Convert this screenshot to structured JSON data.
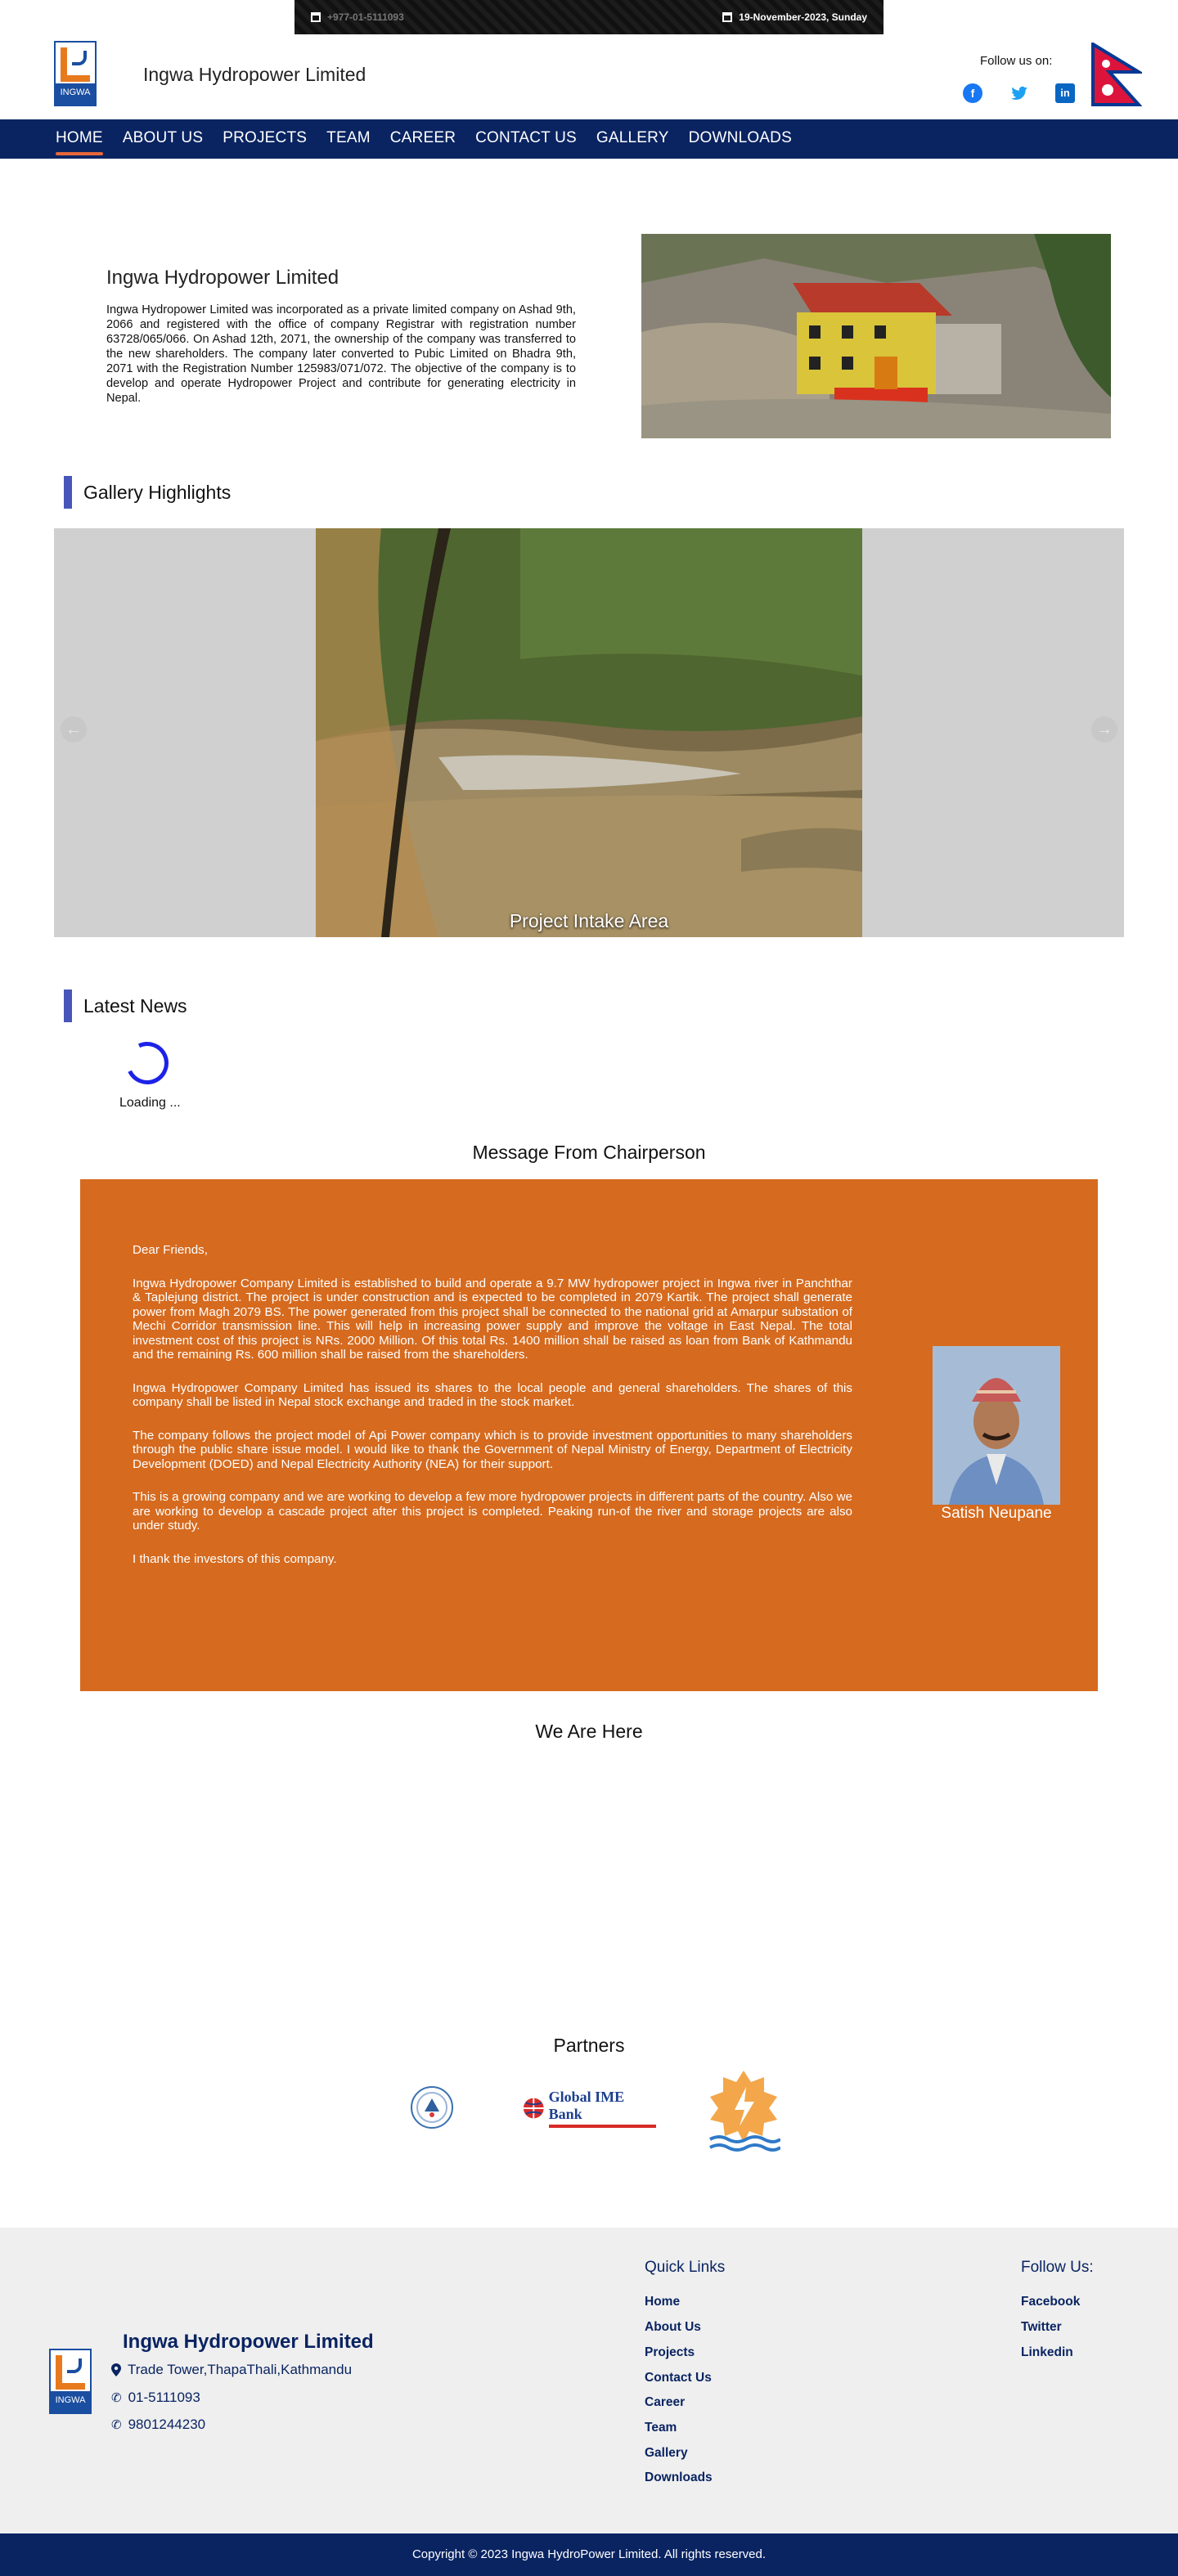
{
  "topbar": {
    "phone": "+977-01-5111093",
    "date": "19-November-2023, Sunday"
  },
  "header": {
    "logo_text": "INGWA",
    "site_title": "Ingwa Hydropower Limited",
    "follow_label": "Follow us on:",
    "social": [
      {
        "icon": "facebook-icon",
        "glyph": "f"
      },
      {
        "icon": "twitter-icon",
        "glyph": "🐦"
      },
      {
        "icon": "linkedin-icon",
        "glyph": "in"
      }
    ]
  },
  "nav": {
    "items": [
      "HOME",
      "ABOUT US",
      "PROJECTS",
      "TEAM",
      "CAREER",
      "CONTACT US",
      "GALLERY",
      "DOWNLOADS"
    ],
    "active": "HOME"
  },
  "about": {
    "title": "Ingwa Hydropower Limited",
    "text": "Ingwa Hydropower Limited was incorporated as a private limited company on Ashad 9th, 2066 and registered with the office of company Registrar with registration number 63728/065/066. On Ashad 12th, 2071, the ownership of the company was transferred to the new shareholders. The company later converted to Pubic Limited on Bhadra 9th, 2071 with the Registration Number 125983/071/072. The objective of the company is to develop and operate Hydropower Project and contribute for generating electricity in Nepal."
  },
  "gallery": {
    "heading": "Gallery Highlights",
    "caption": "Project Intake Area",
    "prev": "←",
    "next": "→"
  },
  "news": {
    "heading": "Latest News",
    "loading": "Loading ..."
  },
  "chair": {
    "heading": "Message From Chairperson",
    "paragraphs": [
      "Dear Friends,",
      "Ingwa Hydropower Company Limited is established to build and operate a 9.7 MW hydropower project in Ingwa river in Panchthar & Taplejung district. The project is under construction and is expected to be completed in 2079 Kartik. The project shall generate power from Magh 2079 BS. The power generated from this project shall be connected to the national grid at Amarpur substation of Mechi Corridor transmission line. This will help in increasing power supply and improve the voltage in East Nepal. The total investment cost of this project is NRs. 2000 Million. Of this total Rs. 1400 million shall be raised as loan from Bank of Kathmandu and the remaining Rs. 600 million shall be raised from the shareholders.",
      "Ingwa Hydropower Company Limited has issued its shares to the local people and general shareholders. The shares of this company shall be listed in Nepal stock exchange and traded in the stock market.",
      "The company follows the project model of Api Power company which is to provide investment opportunities to many shareholders through the public share issue model. I would like to thank the Government of Nepal Ministry of Energy, Department of Electricity Development (DOED) and Nepal Electricity Authority (NEA) for their support.",
      "This is a growing company and we are working to develop a few more hydropower projects in different parts of the country. Also we are working to develop a cascade project after this project is completed. Peaking run-of the river and storage projects are also under study.",
      "I thank the investors of this company."
    ],
    "name": "Satish Neupane"
  },
  "map": {
    "heading": "We Are Here"
  },
  "partners": {
    "heading": "Partners",
    "logos": [
      {
        "icon": "government-emblem-icon",
        "text": ""
      },
      {
        "icon": "global-ime-bank-logo",
        "text": "Global IME Bank"
      },
      {
        "icon": "hydropower-sun-logo",
        "text": ""
      }
    ]
  },
  "footer": {
    "company": "Ingwa Hydropower Limited",
    "address": "Trade Tower,ThapaThali,Kathmandu",
    "phone1": "01-5111093",
    "phone2": "9801244230",
    "quick_links_heading": "Quick Links",
    "quick_links": [
      "Home",
      "About Us",
      "Projects",
      "Contact Us",
      "Career",
      "Team",
      "Gallery",
      "Downloads"
    ],
    "follow_heading": "Follow Us:",
    "follow_links": [
      "Facebook",
      "Twitter",
      "Linkedin"
    ],
    "copyright": "Copyright © 2023 Ingwa HydroPower Limited. All rights reserved."
  },
  "colors": {
    "nav": "#0a2462",
    "accent": "#e8673a",
    "section_bar": "#4756b8",
    "chair_box": "#d66a1e"
  }
}
